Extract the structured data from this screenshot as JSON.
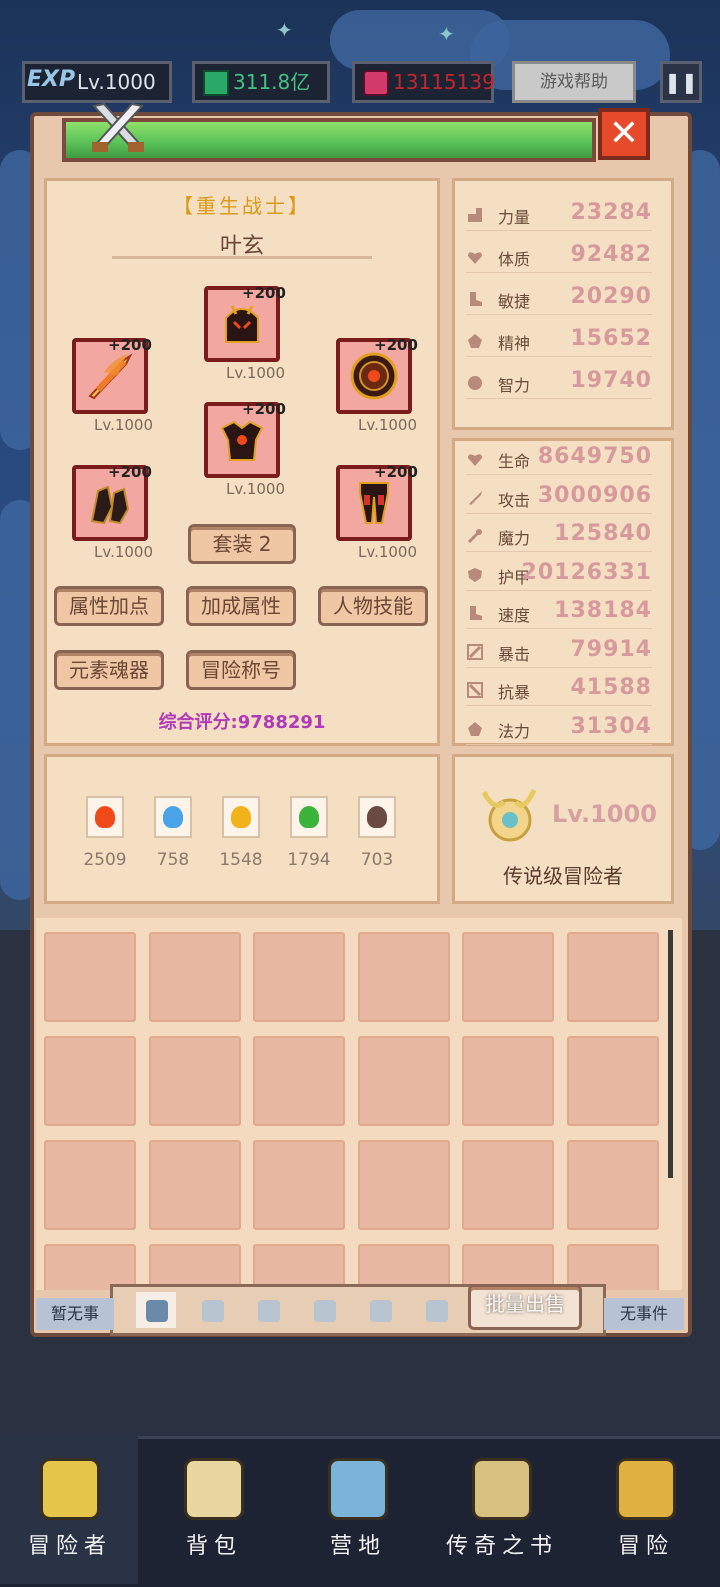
{
  "hud": {
    "exp_label": "EXP",
    "level": "Lv.1000",
    "gems": "311.8亿",
    "crystals": "13115139",
    "help_button": "游戏帮助",
    "pause_icon": "pause-icon"
  },
  "panel": {
    "close_icon": "close-icon",
    "crest_icon": "crossed-swords-icon"
  },
  "character": {
    "class_title": "【重生战士】",
    "name": "叶玄",
    "set_button": "套装 2",
    "score": "综合评分:9788291",
    "equipment": [
      {
        "slot": "weapon",
        "icon": "flame-sword-icon",
        "plus": "+200",
        "level": "Lv.1000"
      },
      {
        "slot": "helmet",
        "icon": "dark-helmet-icon",
        "plus": "+200",
        "level": "Lv.1000"
      },
      {
        "slot": "shield",
        "icon": "round-shield-icon",
        "plus": "+200",
        "level": "Lv.1000"
      },
      {
        "slot": "armor",
        "icon": "dark-armor-icon",
        "plus": "+200",
        "level": "Lv.1000"
      },
      {
        "slot": "gloves",
        "icon": "gauntlet-icon",
        "plus": "+200",
        "level": "Lv.1000"
      },
      {
        "slot": "pants",
        "icon": "leg-armor-icon",
        "plus": "+200",
        "level": "Lv.1000"
      }
    ],
    "buttons": [
      "属性加点",
      "加成属性",
      "人物技能",
      "元素魂器",
      "冒险称号"
    ]
  },
  "base_stats": [
    {
      "name": "力量",
      "value": "23284",
      "icon": "strength-icon"
    },
    {
      "name": "体质",
      "value": "92482",
      "icon": "heart-icon"
    },
    {
      "name": "敏捷",
      "value": "20290",
      "icon": "boot-icon"
    },
    {
      "name": "精神",
      "value": "15652",
      "icon": "spirit-icon"
    },
    {
      "name": "智力",
      "value": "19740",
      "icon": "brain-icon"
    }
  ],
  "combat_stats": [
    {
      "name": "生命",
      "value": "8649750",
      "icon": "heart-icon"
    },
    {
      "name": "攻击",
      "value": "3000906",
      "icon": "sword-icon"
    },
    {
      "name": "魔力",
      "value": "125840",
      "icon": "wand-icon"
    },
    {
      "name": "护甲",
      "value": "20126331",
      "icon": "shield-icon"
    },
    {
      "name": "速度",
      "value": "138184",
      "icon": "boot-icon"
    },
    {
      "name": "暴击",
      "value": "79914",
      "icon": "crit-icon"
    },
    {
      "name": "抗暴",
      "value": "41588",
      "icon": "anti-crit-icon"
    },
    {
      "name": "法力",
      "value": "31304",
      "icon": "spirit-icon"
    }
  ],
  "elements": [
    {
      "icon": "fire-icon",
      "value": "2509",
      "color": "#f04a1a"
    },
    {
      "icon": "water-icon",
      "value": "758",
      "color": "#4aa2e8"
    },
    {
      "icon": "lightning-icon",
      "value": "1548",
      "color": "#f2b21a"
    },
    {
      "icon": "wind-icon",
      "value": "1794",
      "color": "#3cb43c"
    },
    {
      "icon": "skull-icon",
      "value": "703",
      "color": "#6a4a42"
    }
  ],
  "rank": {
    "level": "Lv.1000",
    "title": "传说级冒险者",
    "icon": "legend-emblem-icon"
  },
  "inventory": {
    "rows": 4,
    "cols": 6,
    "sell_button": "批量出售",
    "tabs": [
      "sword-icon",
      "shield-icon",
      "helmet-icon",
      "armor-icon",
      "pants-icon",
      "glove-icon"
    ]
  },
  "side_labels": {
    "left": "暂无事",
    "right": "无事件"
  },
  "nav": [
    {
      "label": "冒险者",
      "icon": "adventurer-icon"
    },
    {
      "label": "背包",
      "icon": "backpack-icon"
    },
    {
      "label": "营地",
      "icon": "camp-icon"
    },
    {
      "label": "传奇之书",
      "icon": "legend-book-icon"
    },
    {
      "label": "冒险",
      "icon": "adventure-icon"
    }
  ]
}
